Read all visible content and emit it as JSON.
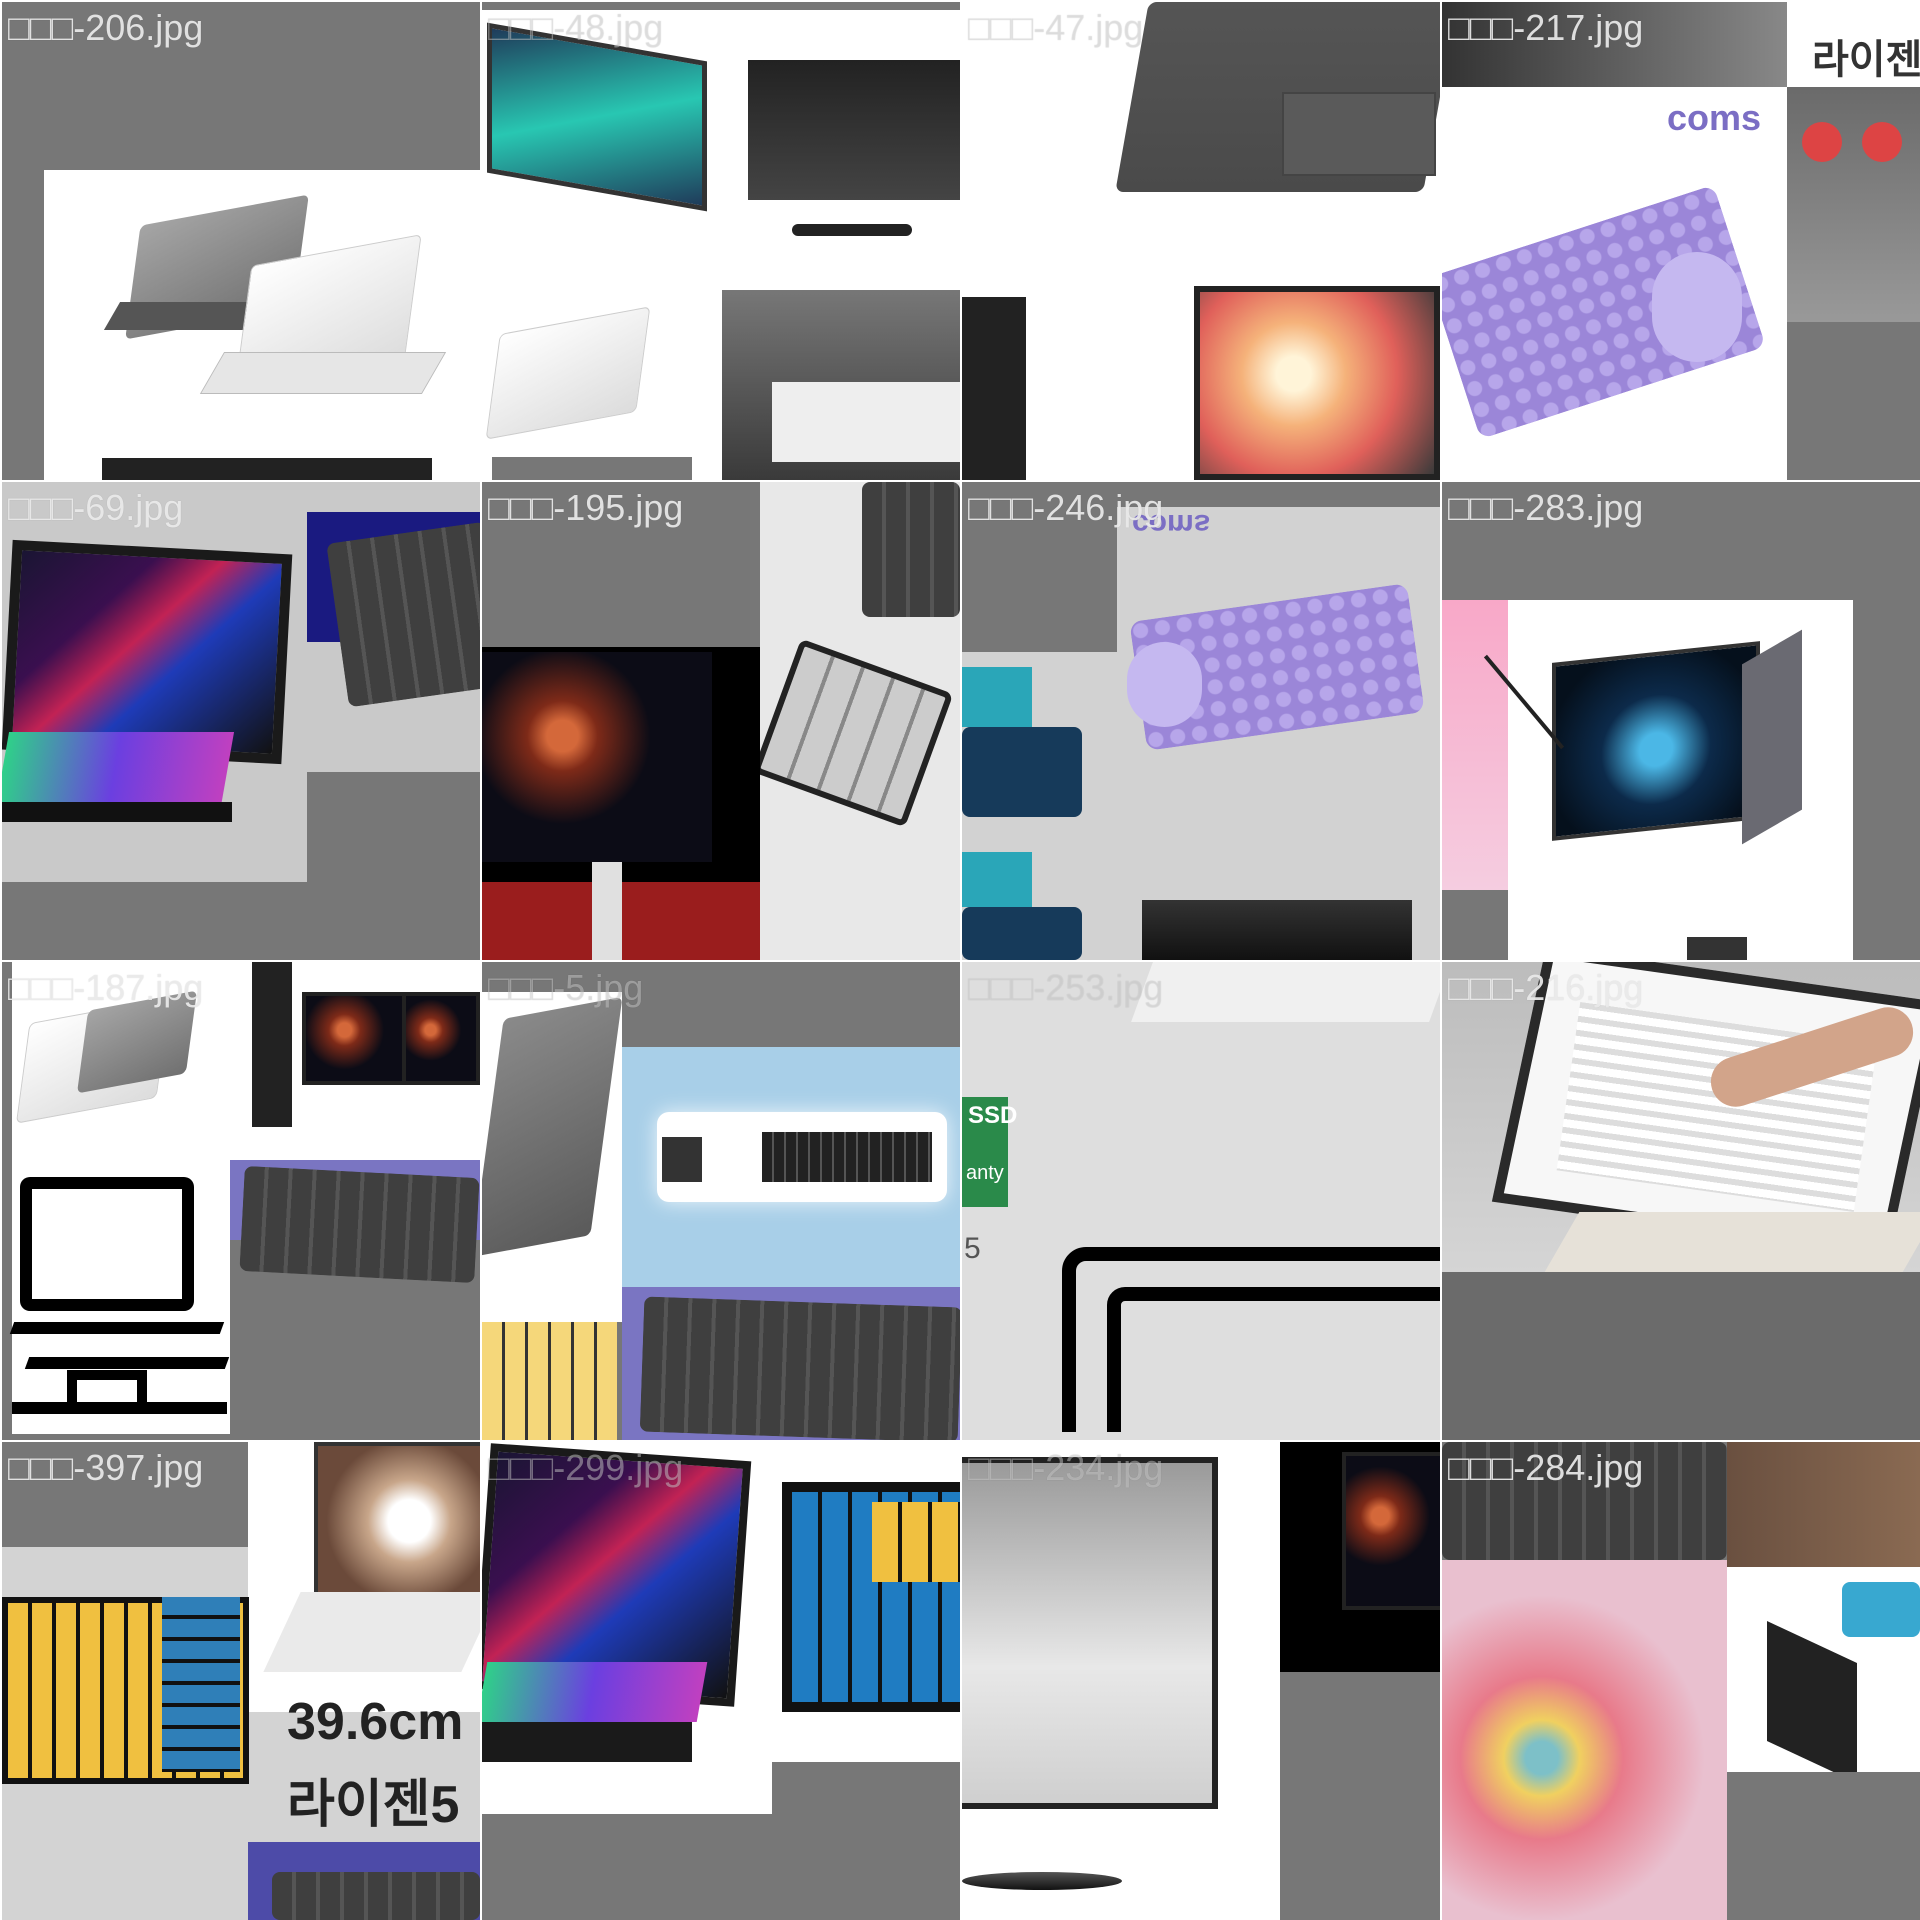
{
  "viewer": {
    "tiles": [
      {
        "name": "□□□-206.jpg"
      },
      {
        "name": "□□□-48.jpg"
      },
      {
        "name": "□□□-47.jpg"
      },
      {
        "name": "□□□-217.jpg"
      },
      {
        "name": "□□□-69.jpg"
      },
      {
        "name": "□□□-195.jpg"
      },
      {
        "name": "□□□-246.jpg"
      },
      {
        "name": "□□□-283.jpg"
      },
      {
        "name": "□□□-187.jpg"
      },
      {
        "name": "□□□-5.jpg"
      },
      {
        "name": "□□□-253.jpg"
      },
      {
        "name": "□□□-216.jpg"
      },
      {
        "name": "□□□-397.jpg"
      },
      {
        "name": "□□□-299.jpg"
      },
      {
        "name": "□□□-234.jpg"
      },
      {
        "name": "□□□-284.jpg"
      }
    ]
  },
  "image_text": {
    "coms_top": "coms",
    "coms_mirror": "coms",
    "size_ko": "39.6cm",
    "brand_ko": "라이젠5",
    "brand_ko_partial": "라이젠",
    "ssd": "SSD",
    "warranty": "anty",
    "digit": "5",
    "partial_size": "39.6"
  },
  "colors": {
    "tile_bg": "#777777",
    "label": "#ebebeb",
    "accent_purple": "#9b86d8",
    "monitor_blue": "#1f4e6e"
  }
}
